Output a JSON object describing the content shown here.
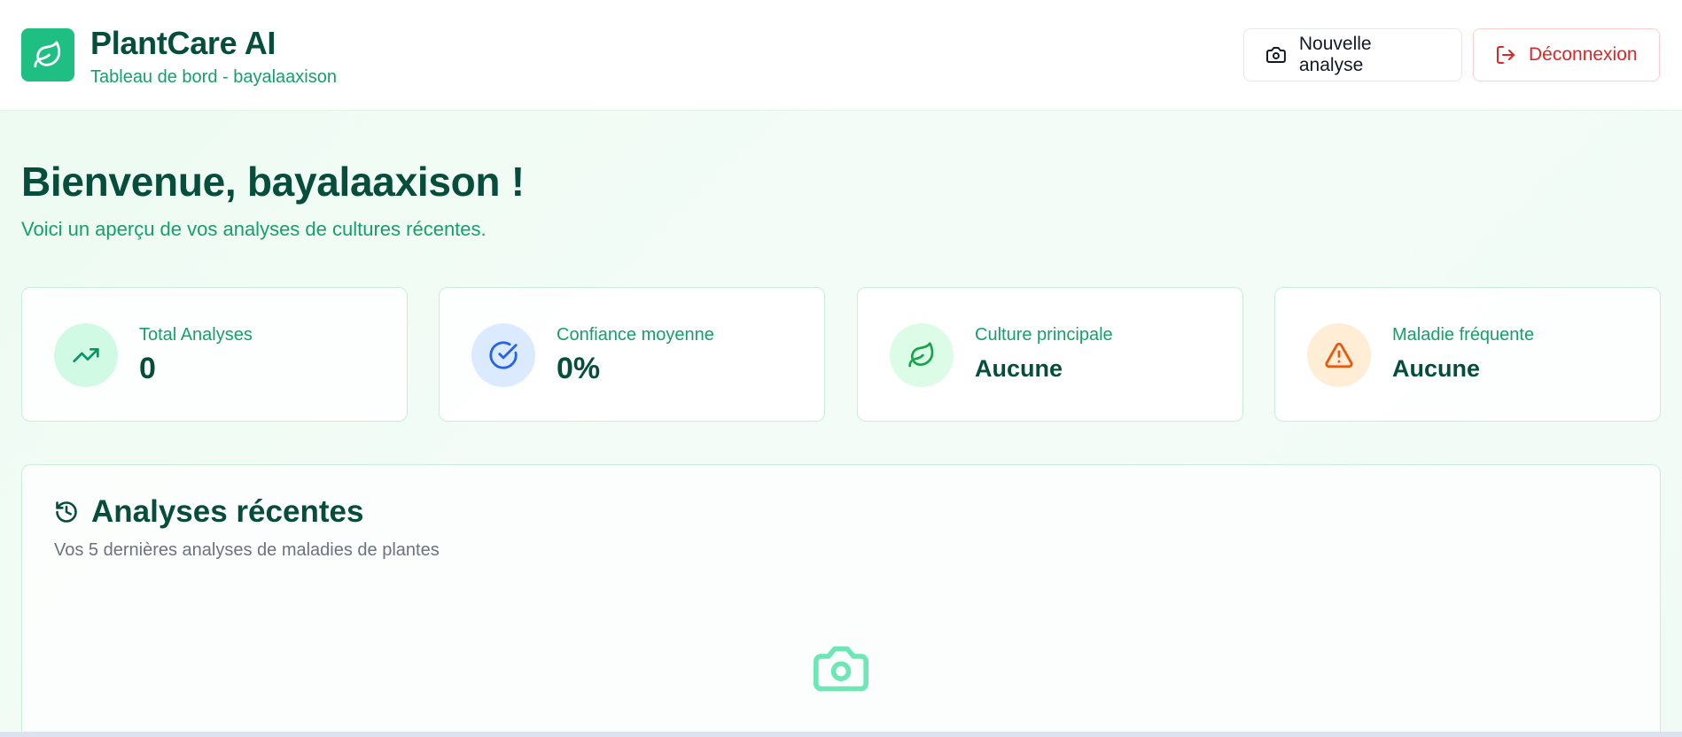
{
  "header": {
    "title": "PlantCare AI",
    "subtitle": "Tableau de bord - bayalaaxison",
    "new_analysis_label": "Nouvelle analyse",
    "logout_label": "Déconnexion"
  },
  "welcome": {
    "title": "Bienvenue, bayalaaxison !",
    "subtitle": "Voici un aperçu de vos analyses de cultures récentes."
  },
  "stats": [
    {
      "label": "Total Analyses",
      "value": "0",
      "icon": "trending-up-icon",
      "color": "#059669"
    },
    {
      "label": "Confiance moyenne",
      "value": "0%",
      "icon": "check-circle-icon",
      "color": "#2563eb"
    },
    {
      "label": "Culture principale",
      "value": "Aucune",
      "icon": "leaf-icon",
      "color": "#16a34a"
    },
    {
      "label": "Maladie fréquente",
      "value": "Aucune",
      "icon": "alert-triangle-icon",
      "color": "#ea580c"
    }
  ],
  "recent": {
    "title": "Analyses récentes",
    "subtitle": "Vos 5 dernières analyses de maladies de plantes",
    "empty_icon": "camera-icon"
  },
  "colors": {
    "brand": "#1fbf84",
    "heading": "#064e3b",
    "accent_text": "#15a06a",
    "danger": "#dc2626"
  }
}
